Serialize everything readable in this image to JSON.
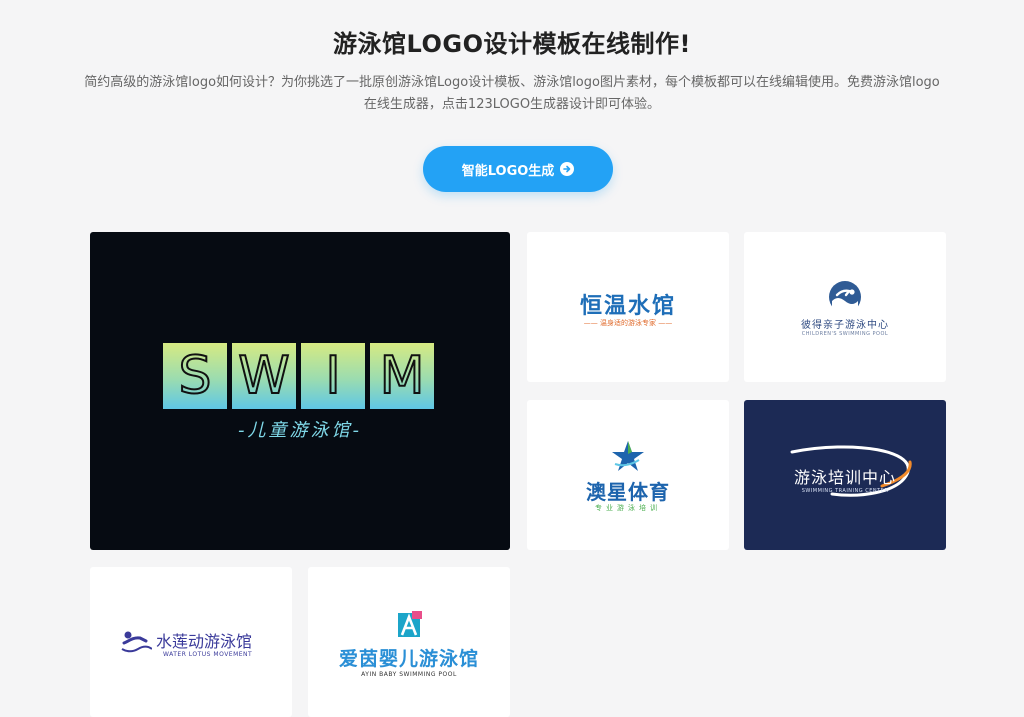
{
  "header": {
    "title": "游泳馆LOGO设计模板在线制作!",
    "description": "简约高级的游泳馆logo如何设计？为你挑选了一批原创游泳馆Logo设计模板、游泳馆logo图片素材，每个模板都可以在线编辑使用。免费游泳馆logo在线生成器，点击123LOGO生成器设计即可体验。"
  },
  "cta": {
    "label": "智能LOGO生成",
    "icon": "arrow-right-circle-icon",
    "color": "#23a2f5"
  },
  "templates": [
    {
      "title": "SWIM",
      "letters": [
        "S",
        "W",
        "I",
        "M"
      ],
      "subtitle": "-儿童游泳馆-",
      "background": "#060b12"
    },
    {
      "title": "恒温水馆",
      "subtitle": "—— 温身适的游泳专家 ——",
      "title_color": "#1e6eb8"
    },
    {
      "title": "彼得亲子游泳中心",
      "subtitle": "CHILDREN'S SWIMMING POOL",
      "icon": "swimmer-wave-icon"
    },
    {
      "title": "澳星体育",
      "subtitle": "专业游泳培训",
      "icon": "star-icon"
    },
    {
      "title": "游泳培训中心",
      "subtitle": "SWIMMING TRAINING CENTER",
      "background": "#1c2a55"
    },
    {
      "title": "水莲动游泳馆",
      "subtitle": "WATER LOTUS MOVEMENT",
      "icon": "swimmer-icon"
    },
    {
      "title": "爱茵婴儿游泳馆",
      "subtitle": "AYIN BABY SWIMMING POOL",
      "icon": "letter-a-icon"
    }
  ]
}
